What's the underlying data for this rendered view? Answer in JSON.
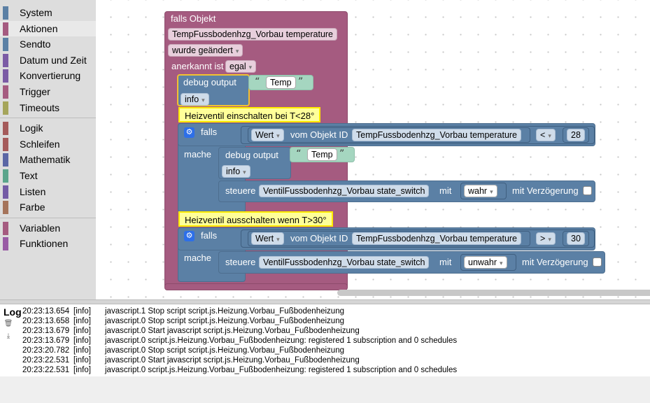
{
  "toolbox": {
    "groups": [
      [
        {
          "label": "System",
          "color": "#5b80a5"
        },
        {
          "label": "Aktionen",
          "color": "#a55b80"
        },
        {
          "label": "Sendto",
          "color": "#5b80a5"
        },
        {
          "label": "Datum und Zeit",
          "color": "#7b5ba5"
        },
        {
          "label": "Konvertierung",
          "color": "#7b5ba5"
        },
        {
          "label": "Trigger",
          "color": "#a55b80"
        },
        {
          "label": "Timeouts",
          "color": "#a5a55b"
        }
      ],
      [
        {
          "label": "Logik",
          "color": "#a55b5b"
        },
        {
          "label": "Schleifen",
          "color": "#a55b5b"
        },
        {
          "label": "Mathematik",
          "color": "#5b67a5"
        },
        {
          "label": "Text",
          "color": "#5ba58c"
        },
        {
          "label": "Listen",
          "color": "#745ba5"
        },
        {
          "label": "Farbe",
          "color": "#a5745b"
        }
      ],
      [
        {
          "label": "Variablen",
          "color": "#a55b80"
        },
        {
          "label": "Funktionen",
          "color": "#995ba5"
        }
      ]
    ],
    "selected_label": "Aktionen"
  },
  "colors": {
    "purple": "#a55b80",
    "blue": "#5b80a5",
    "teal": "#a5d6c0",
    "note_bg": "#ffff99",
    "note_border": "#ffea00",
    "debug_highlight": "#ffcc33"
  },
  "workspace": {
    "trigger": {
      "title": "falls Objekt",
      "object_id": "TempFussbodenhzg_Vorbau temperature",
      "event": "wurde geändert",
      "ack_label": "anerkannt ist",
      "ack_value": "egal"
    },
    "debug1": {
      "label": "debug output",
      "text": "Temp",
      "level": "info"
    },
    "comment1": "Heizventil einschalten bei T<28°",
    "if1": {
      "falls_label": "falls",
      "mache_label": "mache",
      "value_field": "Wert",
      "from_label": "vom Objekt ID",
      "object_id": "TempFussbodenhzg_Vorbau temperature",
      "operator": "<",
      "number": "28",
      "debug": {
        "label": "debug output",
        "text": "Temp",
        "level": "info"
      },
      "control": {
        "label": "steuere",
        "target": "VentilFussbodenhzg_Vorbau state_switch",
        "with_label": "mit",
        "value": "wahr",
        "delay_label": "mit Verzögerung"
      }
    },
    "comment2": "Heizventil ausschalten wenn T>30°",
    "if2": {
      "falls_label": "falls",
      "mache_label": "mache",
      "value_field": "Wert",
      "from_label": "vom Objekt ID",
      "object_id": "TempFussbodenhzg_Vorbau temperature",
      "operator": ">",
      "number": "30",
      "control": {
        "label": "steuere",
        "target": "VentilFussbodenhzg_Vorbau state_switch",
        "with_label": "mit",
        "value": "unwahr",
        "delay_label": "mit Verzögerung"
      }
    }
  },
  "icons": {
    "dropdown": "▾",
    "gear": "⚙",
    "quote_open": "“",
    "quote_close": "”",
    "trash": "🗑",
    "download": "⤓"
  },
  "log": {
    "title": "Log",
    "rows": [
      {
        "time": "20:23:13.654",
        "severity": "[info]",
        "message": "javascript.1 Stop script script.js.Heizung.Vorbau_Fußbodenheizung"
      },
      {
        "time": "20:23:13.658",
        "severity": "[info]",
        "message": "javascript.0 Stop script script.js.Heizung.Vorbau_Fußbodenheizung"
      },
      {
        "time": "20:23:13.679",
        "severity": "[info]",
        "message": "javascript.0 Start javascript script.js.Heizung.Vorbau_Fußbodenheizung"
      },
      {
        "time": "20:23:13.679",
        "severity": "[info]",
        "message": "javascript.0 script.js.Heizung.Vorbau_Fußbodenheizung: registered 1 subscription and 0 schedules"
      },
      {
        "time": "20:23:20.782",
        "severity": "[info]",
        "message": "javascript.0 Stop script script.js.Heizung.Vorbau_Fußbodenheizung"
      },
      {
        "time": "20:23:22.531",
        "severity": "[info]",
        "message": "javascript.0 Start javascript script.js.Heizung.Vorbau_Fußbodenheizung"
      },
      {
        "time": "20:23:22.531",
        "severity": "[info]",
        "message": "javascript.0 script.js.Heizung.Vorbau_Fußbodenheizung: registered 1 subscription and 0 schedules"
      }
    ]
  }
}
